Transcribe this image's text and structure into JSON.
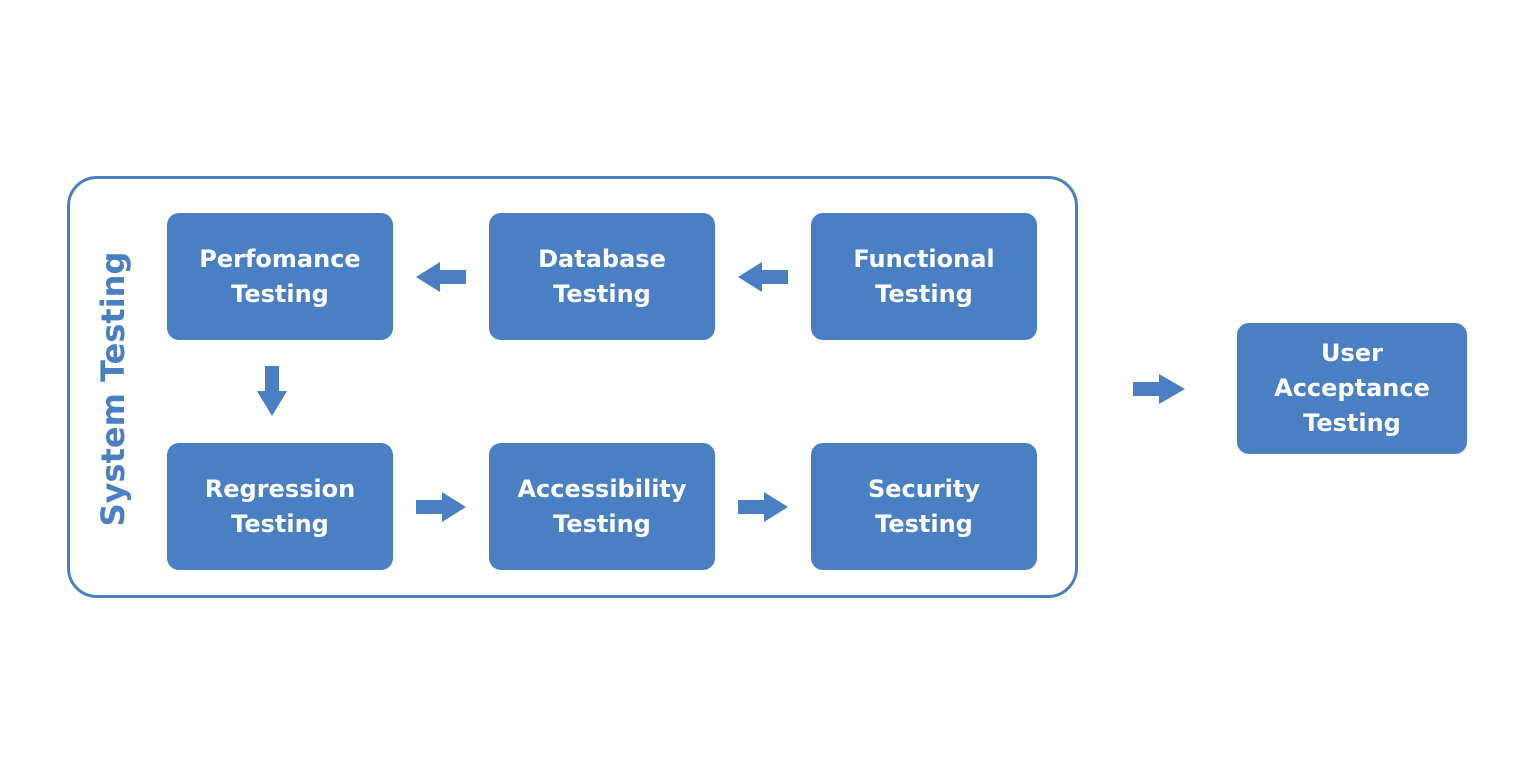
{
  "diagram": {
    "group": {
      "label": "System Testing"
    },
    "nodes": {
      "performance": {
        "lines": [
          "Perfomance",
          "Testing"
        ]
      },
      "database": {
        "lines": [
          "Database",
          "Testing"
        ]
      },
      "functional": {
        "lines": [
          "Functional",
          "Testing"
        ]
      },
      "regression": {
        "lines": [
          "Regression",
          "Testing"
        ]
      },
      "accessibility": {
        "lines": [
          "Accessibility",
          "Testing"
        ]
      },
      "security": {
        "lines": [
          "Security",
          "Testing"
        ]
      },
      "uat": {
        "lines": [
          "User",
          "Acceptance",
          "Testing"
        ]
      }
    },
    "edges": [
      {
        "from": "Functional Testing",
        "to": "Database Testing"
      },
      {
        "from": "Database Testing",
        "to": "Perfomance Testing"
      },
      {
        "from": "Perfomance Testing",
        "to": "Regression Testing"
      },
      {
        "from": "Regression Testing",
        "to": "Accessibility Testing"
      },
      {
        "from": "Accessibility Testing",
        "to": "Security Testing"
      },
      {
        "from": "System Testing",
        "to": "User Acceptance Testing"
      }
    ],
    "colors": {
      "primary": "#4a7fc4",
      "text_on_primary": "#ffffff",
      "background": "#ffffff"
    }
  }
}
